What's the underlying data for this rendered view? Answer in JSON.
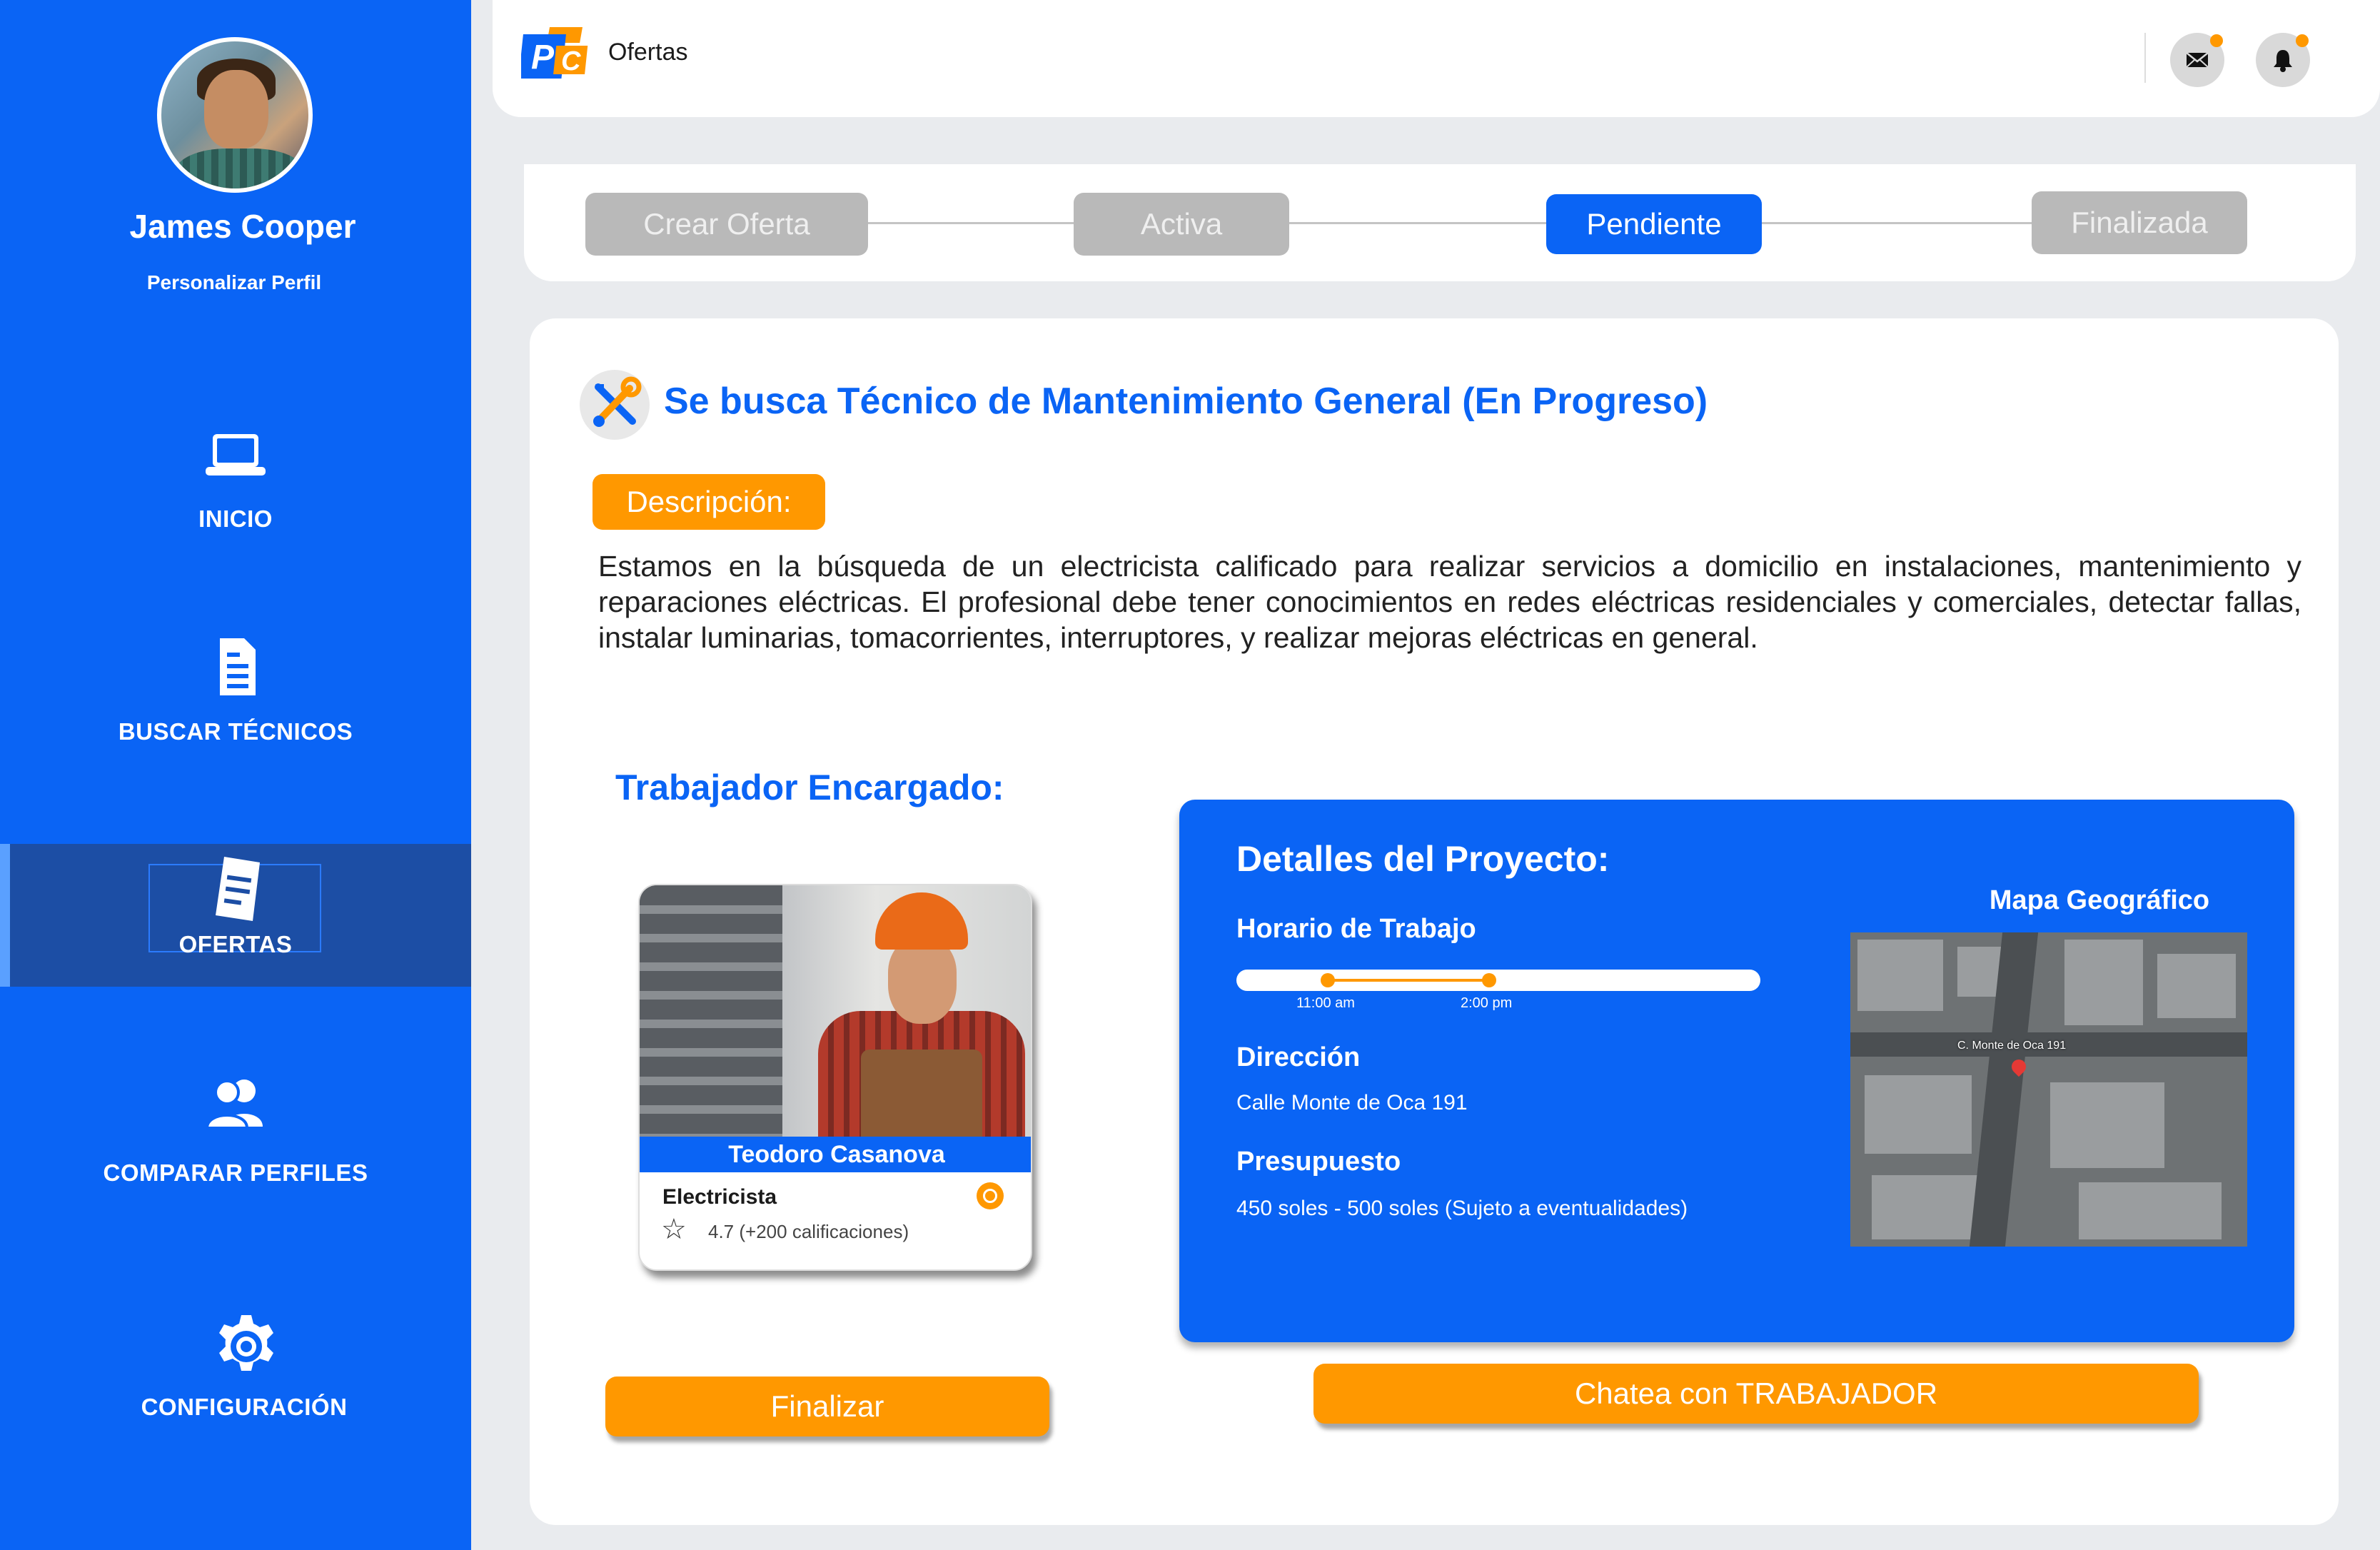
{
  "sidebar": {
    "user_name": "James Cooper",
    "profile_link": "Personalizar Perfil",
    "items": [
      {
        "label": "INICIO",
        "icon": "laptop-icon"
      },
      {
        "label": "BUSCAR TÉCNICOS",
        "icon": "document-icon"
      },
      {
        "label": "OFERTAS",
        "icon": "offers-document-icon",
        "active": true
      },
      {
        "label": "COMPARAR PERFILES",
        "icon": "users-icon"
      },
      {
        "label": "CONFIGURACIÓN",
        "icon": "gear-icon"
      }
    ]
  },
  "topbar": {
    "title": "Ofertas",
    "icons": [
      "mail-icon",
      "bell-icon"
    ]
  },
  "stepper": {
    "steps": [
      {
        "label": "Crear Oferta",
        "state": "inactive"
      },
      {
        "label": "Activa",
        "state": "inactive"
      },
      {
        "label": "Pendiente",
        "state": "active"
      },
      {
        "label": "Finalizada",
        "state": "inactive"
      }
    ]
  },
  "offer": {
    "title": "Se busca Técnico de Mantenimiento General (En Progreso)",
    "description_label": "Descripción:",
    "description": "Estamos en la búsqueda de un electricista calificado para realizar servicios a domicilio en instalaciones, mantenimiento y reparaciones eléctricas. El profesional debe tener conocimientos en redes eléctricas residenciales y comerciales, detectar fallas, instalar luminarias, tomacorrientes, interruptores, y realizar mejoras eléctricas en general."
  },
  "worker": {
    "heading": "Trabajador Encargado:",
    "name": "Teodoro Casanova",
    "role": "Electricista",
    "rating": "4.7 (+200 calificaciones)",
    "finish_button": "Finalizar"
  },
  "details": {
    "heading": "Detalles del Proyecto:",
    "schedule_label": "Horario de Trabajo",
    "schedule_start": "11:00 am",
    "schedule_end": "2:00 pm",
    "address_label": "Dirección",
    "address": "Calle Monte de Oca 191",
    "budget_label": "Presupuesto",
    "budget": "450 soles - 500 soles (Sujeto a eventualidades)",
    "map_title": "Mapa Geográfico",
    "map_label": "C. Monte de Oca 191",
    "chat_button": "Chatea con TRABAJADOR"
  },
  "colors": {
    "primary": "#0a64f5",
    "accent": "#ff9800",
    "sidebar_active": "#1c4ea5",
    "step_inactive": "#b9b9b9"
  }
}
